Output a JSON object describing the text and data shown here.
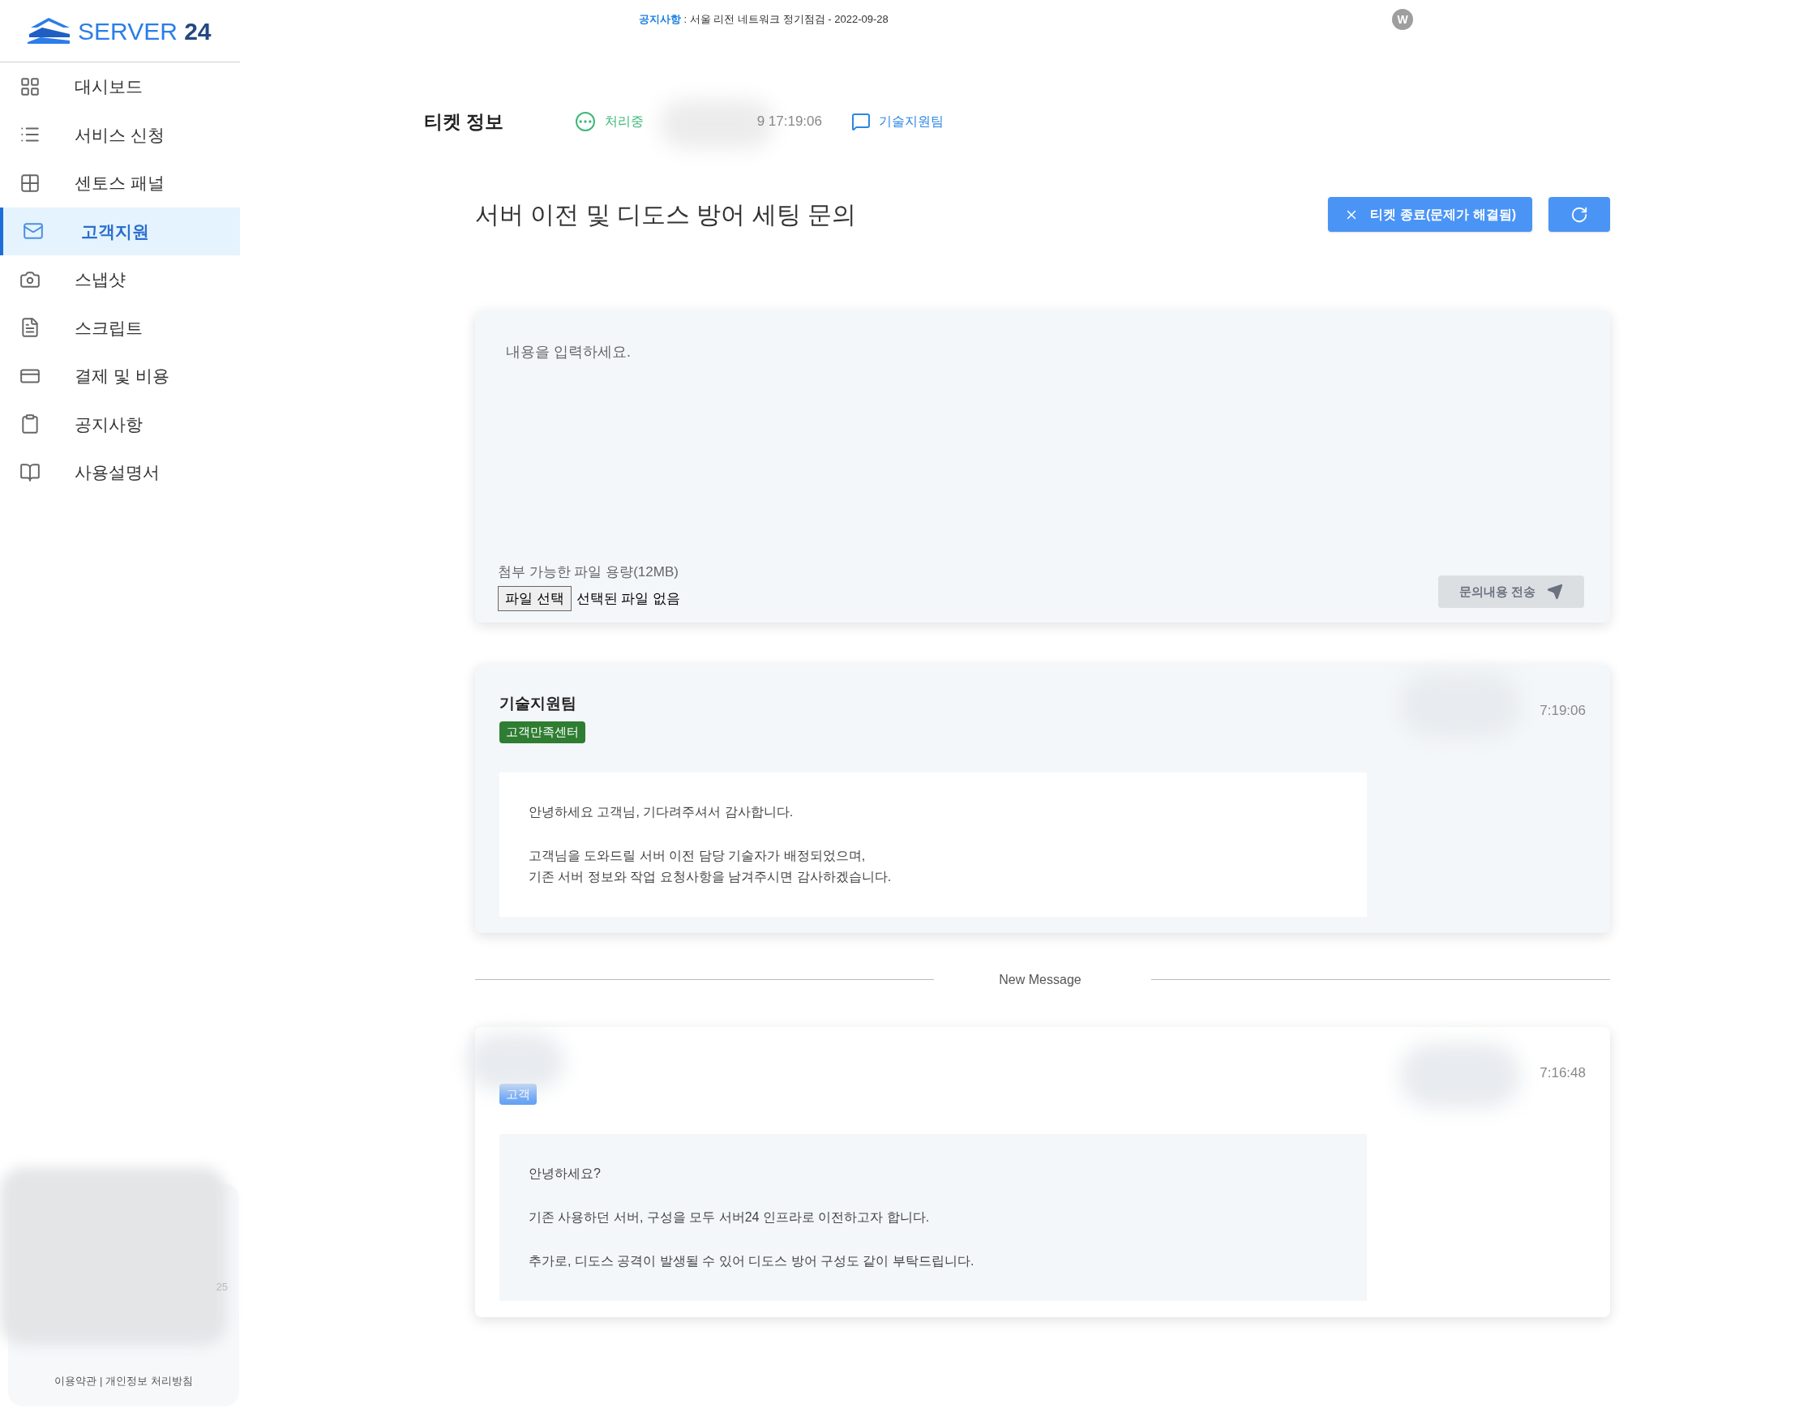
{
  "logo": {
    "text": "SERVER",
    "number": "24"
  },
  "notice": {
    "label": "공지사항",
    "text": " : 서울 리전 네트워크 정기점검 - 2022-09-28"
  },
  "avatar": "W",
  "sidebar": {
    "items": [
      {
        "label": "대시보드",
        "selected": false
      },
      {
        "label": "서비스 신청",
        "selected": false
      },
      {
        "label": "센토스 패널",
        "selected": false
      },
      {
        "label": "고객지원",
        "selected": true
      },
      {
        "label": "스냅샷",
        "selected": false
      },
      {
        "label": "스크립트",
        "selected": false
      },
      {
        "label": "결제 및 비용",
        "selected": false
      },
      {
        "label": "공지사항",
        "selected": false
      },
      {
        "label": "사용설명서",
        "selected": false
      }
    ],
    "footer": {
      "partial": "25",
      "links": "이용약관 | 개인정보 처리방침"
    }
  },
  "ticket": {
    "heading": "티켓 정보",
    "status": "처리중",
    "time": "9 17:19:06",
    "team": "기술지원팀",
    "title": "서버 이전 및 디도스 방어 세팅 문의",
    "close_button": "티켓 종료(문제가 해결됨)"
  },
  "compose": {
    "placeholder": "내용을 입력하세요.",
    "attach_hint": "첨부 가능한 파일 용량(12MB)",
    "file_button": "파일 선택",
    "file_status": "선택된 파일 없음",
    "send_button": "문의내용 전송",
    "send_disabled": true
  },
  "messages": [
    {
      "kind": "staff",
      "author": "기술지원팀",
      "badge": "고객만족센터",
      "time": "7:19:06",
      "paragraphs": [
        "안녕하세요 고객님, 기다려주셔서 감사합니다.",
        "고객님을 도와드릴 서버 이전 담당 기술자가 배정되었으며,\n기존 서버 정보와 작업 요청사항을 남겨주시면 감사하겠습니다."
      ]
    },
    {
      "kind": "divider",
      "label": "New Message"
    },
    {
      "kind": "customer",
      "badge": "고객",
      "time": "7:16:48",
      "paragraphs": [
        "안녕하세요?",
        "기존 사용하던 서버, 구성을 모두 서버24 인프라로 이전하고자 합니다.",
        "추가로, 디도스 공격이 발생될 수 있어 디도스 방어 구성도 같이 부탁드립니다."
      ]
    }
  ]
}
